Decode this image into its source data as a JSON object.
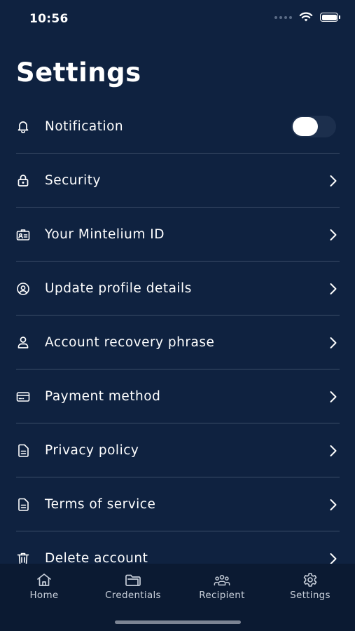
{
  "status_bar": {
    "time": "10:56"
  },
  "header": {
    "title": "Settings"
  },
  "settings": {
    "items": [
      {
        "label": "Notification",
        "icon": "bell-icon",
        "control": "toggle",
        "enabled": false
      },
      {
        "label": "Security",
        "icon": "lock-icon",
        "control": "chevron"
      },
      {
        "label": "Your Mintelium ID",
        "icon": "id-card-icon",
        "control": "chevron"
      },
      {
        "label": "Update profile details",
        "icon": "user-circle-icon",
        "control": "chevron"
      },
      {
        "label": "Account recovery phrase",
        "icon": "user-icon",
        "control": "chevron"
      },
      {
        "label": "Payment method",
        "icon": "credit-card-icon",
        "control": "chevron"
      },
      {
        "label": "Privacy policy",
        "icon": "document-icon",
        "control": "chevron"
      },
      {
        "label": "Terms of service",
        "icon": "document-icon",
        "control": "chevron"
      },
      {
        "label": "Delete account",
        "icon": "trash-icon",
        "control": "chevron"
      }
    ]
  },
  "tab_bar": {
    "tabs": [
      {
        "label": "Home",
        "icon": "home-icon"
      },
      {
        "label": "Credentials",
        "icon": "folder-icon"
      },
      {
        "label": "Recipient",
        "icon": "group-icon"
      },
      {
        "label": "Settings",
        "icon": "gear-icon"
      }
    ]
  },
  "colors": {
    "background": "#0f2240",
    "tab_bar_background": "#0b1a32",
    "divider": "#3b4d68",
    "text": "#ffffff"
  }
}
